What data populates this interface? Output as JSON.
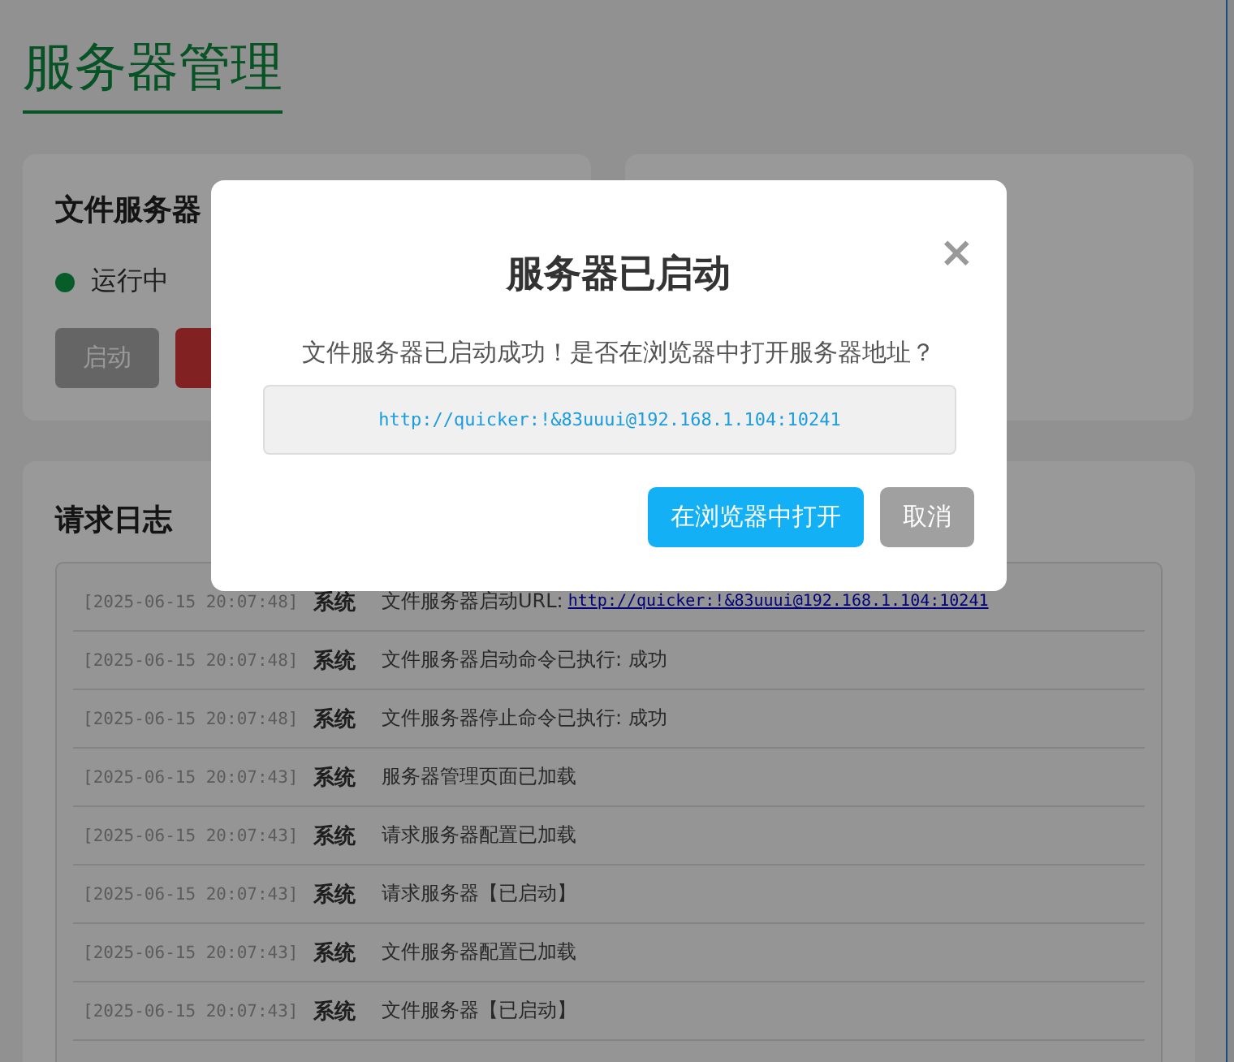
{
  "page": {
    "title": "服务器管理"
  },
  "server_card": {
    "title": "文件服务器",
    "status": {
      "label": "运行中",
      "running": true
    },
    "buttons": [
      {
        "label": "启动",
        "disabled": true,
        "kind": "start"
      },
      {
        "disabled": false,
        "kind": "stop"
      }
    ]
  },
  "log": {
    "title": "请求日志",
    "entries": [
      {
        "time": "[2025-06-15 20:07:48]",
        "source": "系统",
        "message": "文件服务器启动URL:",
        "link": "http://quicker:!&83uuui@192.168.1.104:10241"
      },
      {
        "time": "[2025-06-15 20:07:48]",
        "source": "系统",
        "message": "文件服务器启动命令已执行: 成功"
      },
      {
        "time": "[2025-06-15 20:07:48]",
        "source": "系统",
        "message": "文件服务器停止命令已执行: 成功"
      },
      {
        "time": "[2025-06-15 20:07:43]",
        "source": "系统",
        "message": "服务器管理页面已加载"
      },
      {
        "time": "[2025-06-15 20:07:43]",
        "source": "系统",
        "message": "请求服务器配置已加载"
      },
      {
        "time": "[2025-06-15 20:07:43]",
        "source": "系统",
        "message": "请求服务器【已启动】"
      },
      {
        "time": "[2025-06-15 20:07:43]",
        "source": "系统",
        "message": "文件服务器配置已加载"
      },
      {
        "time": "[2025-06-15 20:07:43]",
        "source": "系统",
        "message": "文件服务器【已启动】"
      }
    ]
  },
  "dialog": {
    "title": "服务器已启动",
    "close": "×",
    "message": "文件服务器已启动成功！是否在浏览器中打开服务器地址？",
    "url": "http://quicker:!&83uuui@192.168.1.104:10241",
    "buttons": [
      {
        "label": "在浏览器中打开",
        "kind": "primary"
      },
      {
        "label": "取消",
        "kind": "secondary"
      }
    ]
  }
}
